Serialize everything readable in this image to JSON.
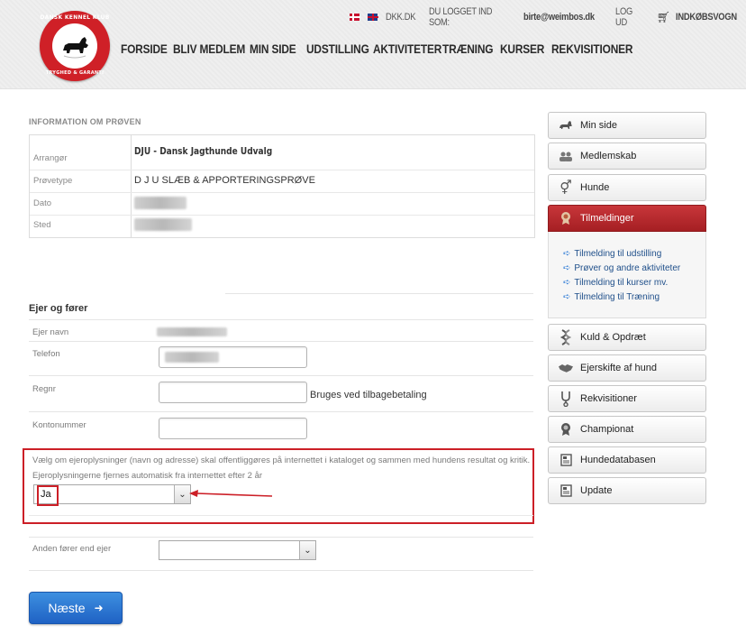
{
  "logo": {
    "top_text": "DANSK KENNEL KLUB",
    "bottom_text": "TRYGHED & GARANTI"
  },
  "topbar": {
    "site_link": "DKK.DK",
    "logged_in_label": "DU LOGGET IND SOM:",
    "user_email": "birte@weimbos.dk",
    "logout": "LOG UD",
    "cart": "INDKØBSVOGN"
  },
  "nav": {
    "items": [
      "FORSIDE",
      "BLIV MEDLEM",
      "MIN SIDE",
      "UDSTILLING",
      "AKTIVITETER",
      "TRÆNING",
      "KURSER",
      "REKVISITIONER"
    ]
  },
  "info": {
    "heading": "INFORMATION OM PRØVEN",
    "rows": [
      {
        "label": "Arrangør",
        "value": "DJU - Dansk Jagthunde Udvalg"
      },
      {
        "label": "Prøvetype",
        "value": "D J U SLÆB & APPORTERINGSPRØVE"
      },
      {
        "label": "Dato",
        "value": ""
      },
      {
        "label": "Sted",
        "value": ""
      }
    ]
  },
  "owner": {
    "heading": "Ejer og fører",
    "owner_name_label": "Ejer navn",
    "phone_label": "Telefon",
    "regnr_label": "Regnr",
    "refund_note": "Bruges ved tilbagebetaling",
    "account_label": "Kontonummer"
  },
  "consent": {
    "text1": "Vælg om ejeroplysninger (navn og adresse) skal offentliggøres på internettet i kataloget og sammen med hundens resultat og kritik.",
    "text2": "Ejeroplysningerne fjernes automatisk fra internettet efter 2 år",
    "selected": "Ja"
  },
  "other_handler": {
    "label": "Anden fører end ejer",
    "selected": ""
  },
  "next_button": "Næste",
  "sidebar": {
    "items": [
      {
        "label": "Min side",
        "icon": "dog-icon"
      },
      {
        "label": "Medlemskab",
        "icon": "people-icon"
      },
      {
        "label": "Hunde",
        "icon": "gender-icon"
      },
      {
        "label": "Tilmeldinger",
        "icon": "rosette-icon"
      },
      {
        "label": "Kuld & Opdræt",
        "icon": "dna-icon"
      },
      {
        "label": "Ejerskifte af hund",
        "icon": "handshake-icon"
      },
      {
        "label": "Rekvisitioner",
        "icon": "stethoscope-icon"
      },
      {
        "label": "Championat",
        "icon": "rosette-icon"
      },
      {
        "label": "Hundedatabasen",
        "icon": "database-icon"
      },
      {
        "label": "Update",
        "icon": "database-icon"
      }
    ],
    "submenu": [
      "Tilmelding til udstilling",
      "Prøver og andre aktiviteter",
      "Tilmelding til kurser mv.",
      "Tilmelding til Træning"
    ]
  },
  "colors": {
    "brand_red": "#cc1f27",
    "active_tab": "#b02a2e",
    "button_blue": "#2a74d2"
  }
}
